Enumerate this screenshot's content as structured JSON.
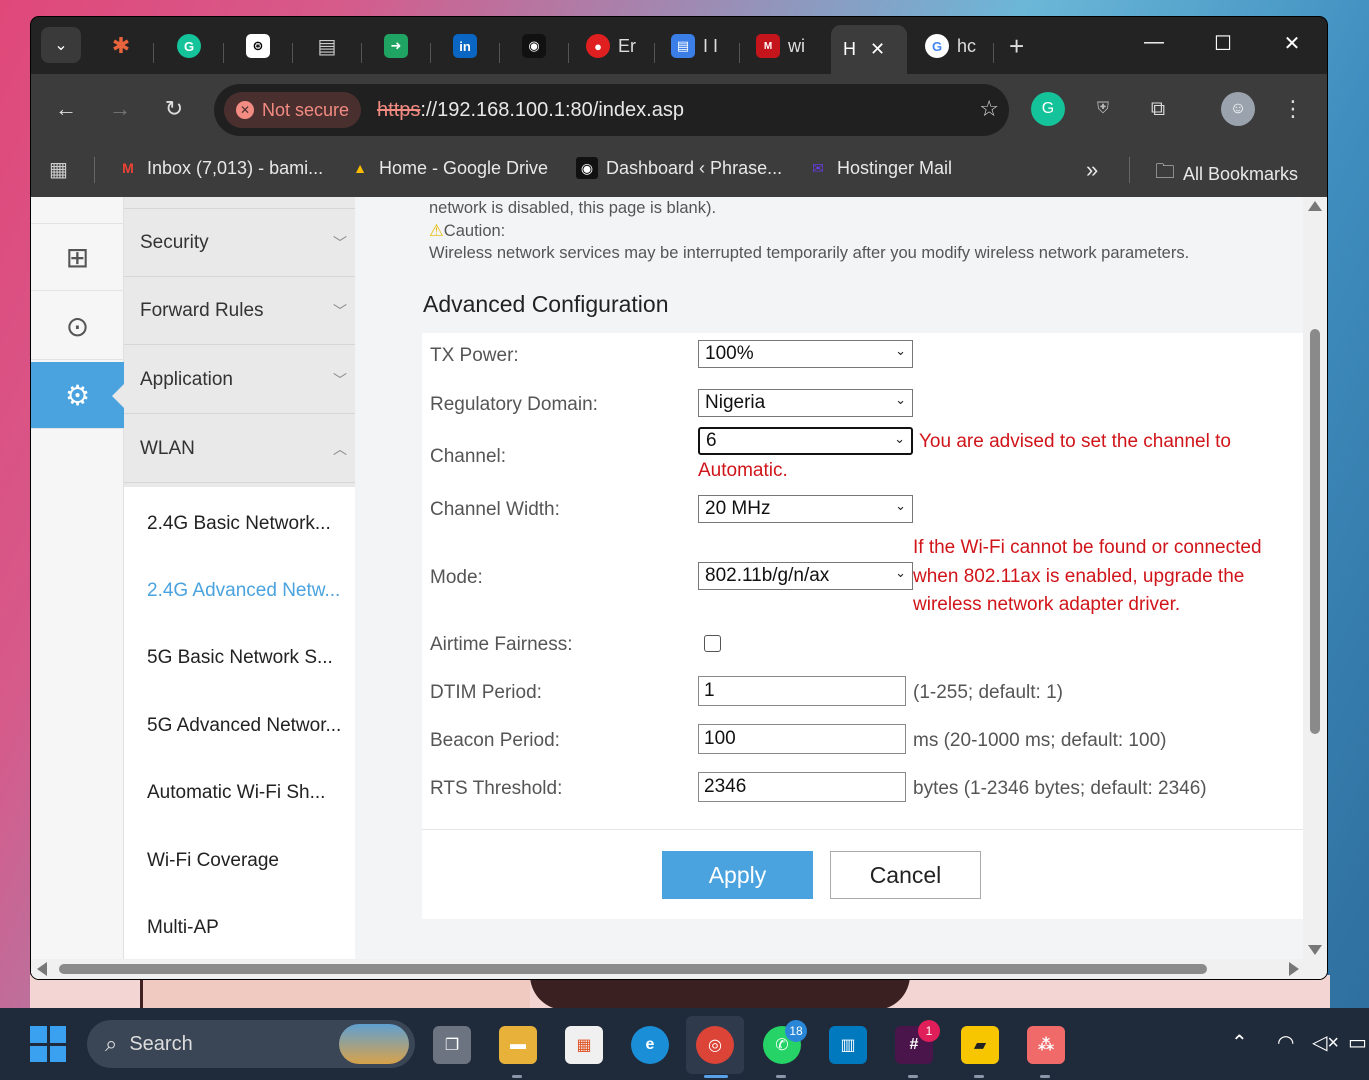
{
  "browser": {
    "tabs": [
      {
        "name": "tab-1",
        "label": "",
        "color": "#e8643c",
        "glyph": "✱"
      },
      {
        "name": "tab-2",
        "label": "",
        "color": "#15c39a",
        "glyph": "G"
      },
      {
        "name": "tab-3",
        "label": "",
        "color": "#ffffff",
        "glyph": "⊛"
      },
      {
        "name": "tab-4",
        "label": "",
        "color": "#cccccc",
        "glyph": "▤"
      },
      {
        "name": "tab-5",
        "label": "",
        "color": "#1fa463",
        "glyph": "➜"
      },
      {
        "name": "tab-6",
        "label": "",
        "color": "#0a66c2",
        "glyph": "in"
      },
      {
        "name": "tab-7",
        "label": "",
        "color": "#111111",
        "glyph": "◉"
      },
      {
        "name": "tab-8",
        "label": "Er",
        "color": "#e02020",
        "glyph": "●"
      },
      {
        "name": "tab-9",
        "label": "I I",
        "color": "#3b7ee8",
        "glyph": "▤"
      },
      {
        "name": "tab-10",
        "label": "wi",
        "color": "#c4141c",
        "glyph": "M"
      }
    ],
    "active_tab": {
      "label": "H"
    },
    "last_tab": {
      "label": "hc"
    },
    "address": {
      "security_label": "Not secure",
      "url_scheme": "https",
      "url_rest": "://192.168.100.1:80/index.asp"
    },
    "bookmarks": [
      {
        "label": "Inbox (7,013) - bami...",
        "color": "#ea4335",
        "glyph": "M"
      },
      {
        "label": "Home - Google Drive",
        "color": "#fbbc04",
        "glyph": "▲"
      },
      {
        "label": "Dashboard ‹ Phrase...",
        "color": "#111111",
        "glyph": "◉"
      },
      {
        "label": "Hostinger Mail",
        "color": "#673de6",
        "glyph": "✉"
      }
    ],
    "all_bookmarks": "All Bookmarks"
  },
  "router": {
    "menu": [
      {
        "label": "Security",
        "expanded": false
      },
      {
        "label": "Forward Rules",
        "expanded": false
      },
      {
        "label": "Application",
        "expanded": false
      },
      {
        "label": "WLAN",
        "expanded": true
      }
    ],
    "submenu": [
      {
        "label": "2.4G Basic Network...",
        "active": false
      },
      {
        "label": "2.4G Advanced Netw...",
        "active": true
      },
      {
        "label": "5G Basic Network S...",
        "active": false
      },
      {
        "label": "5G Advanced Networ...",
        "active": false
      },
      {
        "label": "Automatic Wi-Fi Sh...",
        "active": false
      },
      {
        "label": "Wi-Fi Coverage",
        "active": false
      },
      {
        "label": "Multi-AP",
        "active": false
      }
    ],
    "notes": {
      "disabled_line": "network is disabled, this page is blank).",
      "caution_label": "Caution:",
      "caution_text": "Wireless network services may be interrupted temporarily after you modify wireless network parameters."
    },
    "section_title": "Advanced Configuration",
    "form": {
      "tx_power": {
        "label": "TX Power:",
        "value": "100%"
      },
      "regulatory_domain": {
        "label": "Regulatory Domain:",
        "value": "Nigeria"
      },
      "channel": {
        "label": "Channel:",
        "value": "6",
        "warning_line1": "You are advised to set the channel to",
        "warning_line2": "Automatic."
      },
      "channel_width": {
        "label": "Channel Width:",
        "value": "20 MHz"
      },
      "mode": {
        "label": "Mode:",
        "value": "802.11b/g/n/ax",
        "warning_line1": "If the Wi-Fi cannot be found or connected",
        "warning_line2": "when 802.11ax is enabled, upgrade the",
        "warning_line3": "wireless network adapter driver."
      },
      "airtime_fairness": {
        "label": "Airtime Fairness:",
        "checked": false
      },
      "dtim_period": {
        "label": "DTIM Period:",
        "value": "1",
        "hint": "(1-255; default: 1)"
      },
      "beacon_period": {
        "label": "Beacon Period:",
        "value": "100",
        "hint": "ms (20-1000 ms; default: 100)"
      },
      "rts_threshold": {
        "label": "RTS Threshold:",
        "value": "2346",
        "hint": "bytes (1-2346 bytes; default: 2346)"
      }
    },
    "buttons": {
      "apply": "Apply",
      "cancel": "Cancel"
    }
  },
  "taskbar": {
    "search_label": "Search",
    "whatsapp_badge": "18",
    "slack_badge": "1"
  },
  "colors": {
    "accent": "#4aa3df",
    "warning": "#d0151a"
  }
}
